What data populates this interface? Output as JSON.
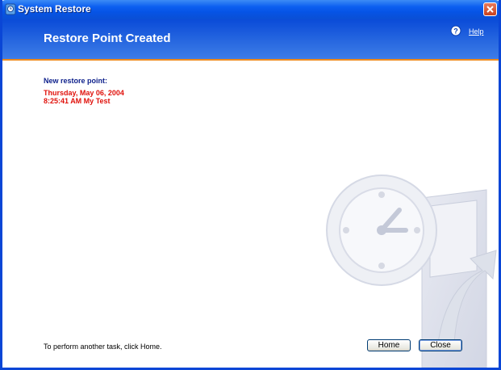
{
  "window": {
    "title": "System Restore"
  },
  "header": {
    "title": "Restore Point Created",
    "help_label": "Help"
  },
  "content": {
    "label": "New restore point:",
    "restore_date": "Thursday, May 06, 2004",
    "restore_time_desc": "8:25:41 AM  My Test"
  },
  "footer": {
    "instruction": "To perform another task, click Home.",
    "home_label": "Home",
    "close_label": "Close"
  },
  "colors": {
    "header_blue": "#0a4bd8",
    "accent_orange": "#f08a1c",
    "label_blue": "#0b1e8a",
    "restore_red": "#e0100a"
  },
  "icons": [
    "system-restore-icon",
    "close-icon",
    "help-icon",
    "clock-watermark"
  ]
}
